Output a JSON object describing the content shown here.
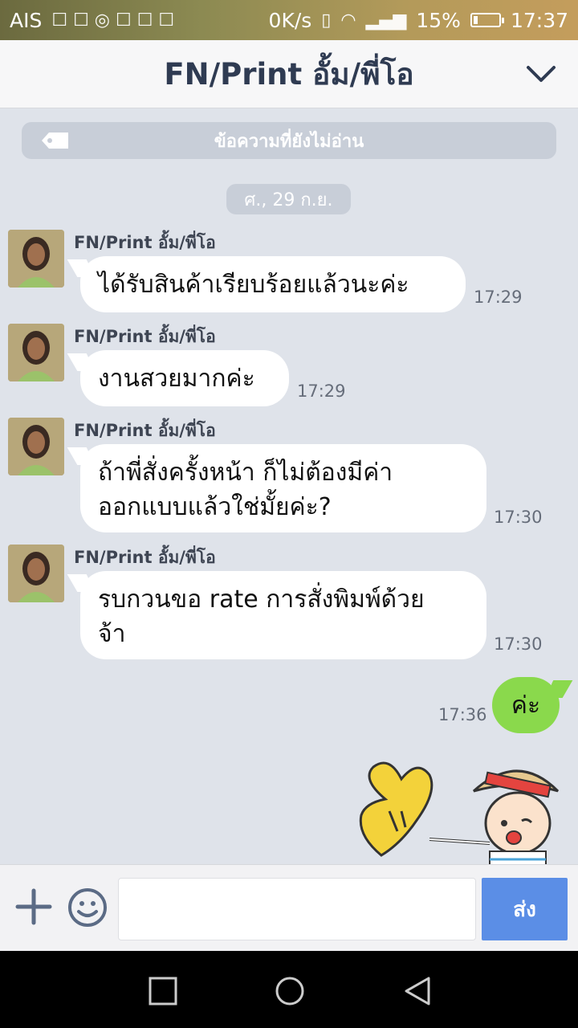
{
  "status_bar": {
    "carrier": "AIS",
    "speed": "0K/s",
    "battery": "15%",
    "battery_level": 0.15,
    "time": "17:37"
  },
  "header": {
    "title": "FN/Print อั้ม/พี่โอ"
  },
  "unread_banner": "ข้อความที่ยังไม่อ่าน",
  "date_separator": "ศ., 29 ก.ย.",
  "messages": [
    {
      "sender": "FN/Print อั้ม/พี่โอ",
      "text": "ได้รับสินค้าเรียบร้อยแล้วนะค่ะ",
      "time": "17:29"
    },
    {
      "sender": "FN/Print อั้ม/พี่โอ",
      "text": "งานสวยมากค่ะ",
      "time": "17:29"
    },
    {
      "sender": "FN/Print อั้ม/พี่โอ",
      "text_lines": [
        "ถ้าพี่สั่งครั้งหน้า ก็ไม่ต้องมีค่า",
        "ออกแบบแล้วใช่มั้ยค่ะ?"
      ],
      "time": "17:30"
    },
    {
      "sender": "FN/Print อั้ม/พี่โอ",
      "text_lines": [
        "รบกวนขอ rate การสั่งพิมพ์ด้วย",
        "จ้า"
      ],
      "time": "17:30"
    }
  ],
  "my_message": {
    "text": "ค่ะ",
    "time": "17:36"
  },
  "composer": {
    "placeholder": "",
    "send_label": "ส่ง"
  },
  "colors": {
    "chat_bg": "#dfe3ea",
    "my_bubble": "#8ad94c",
    "send_button": "#5b8ee6",
    "header_title": "#2f3b52"
  },
  "icons": {
    "header_chevron": "chevron-down-icon",
    "unread_tag": "tag-icon",
    "composer_plus": "plus-icon",
    "composer_emoji": "smile-icon",
    "nav_recent": "square-icon",
    "nav_home": "circle-icon",
    "nav_back": "triangle-back-icon"
  }
}
